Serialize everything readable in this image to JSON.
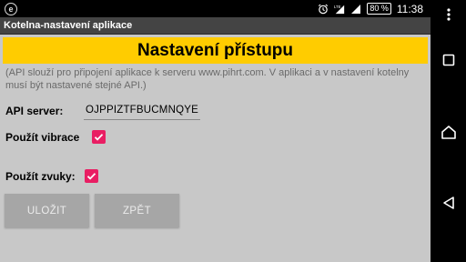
{
  "status_bar": {
    "battery_percent": "80 %",
    "time": "11:38",
    "network_label": "LTE"
  },
  "app": {
    "title": "Kotelna-nastavení aplikace",
    "banner": "Nastavení přístupu",
    "hint": "(API slouží pro připojení aplikace k serveru www.pihrt.com. V aplikaci a v nastavení kotelny musí být nastavené stejné API.)",
    "api_label": "API server:",
    "api_value": "OJPPIZTFBUCMNQYE",
    "vibration_label": "Použít vibrace",
    "vibration_checked": true,
    "sound_label": "Použít zvuky:",
    "sound_checked": true,
    "save_label": "ULOŽIT",
    "back_label": "ZPĚT"
  },
  "colors": {
    "banner": "#ffcc00",
    "checkbox": "#e91e63",
    "background": "#c8c8c8",
    "titlebar": "#444444"
  }
}
